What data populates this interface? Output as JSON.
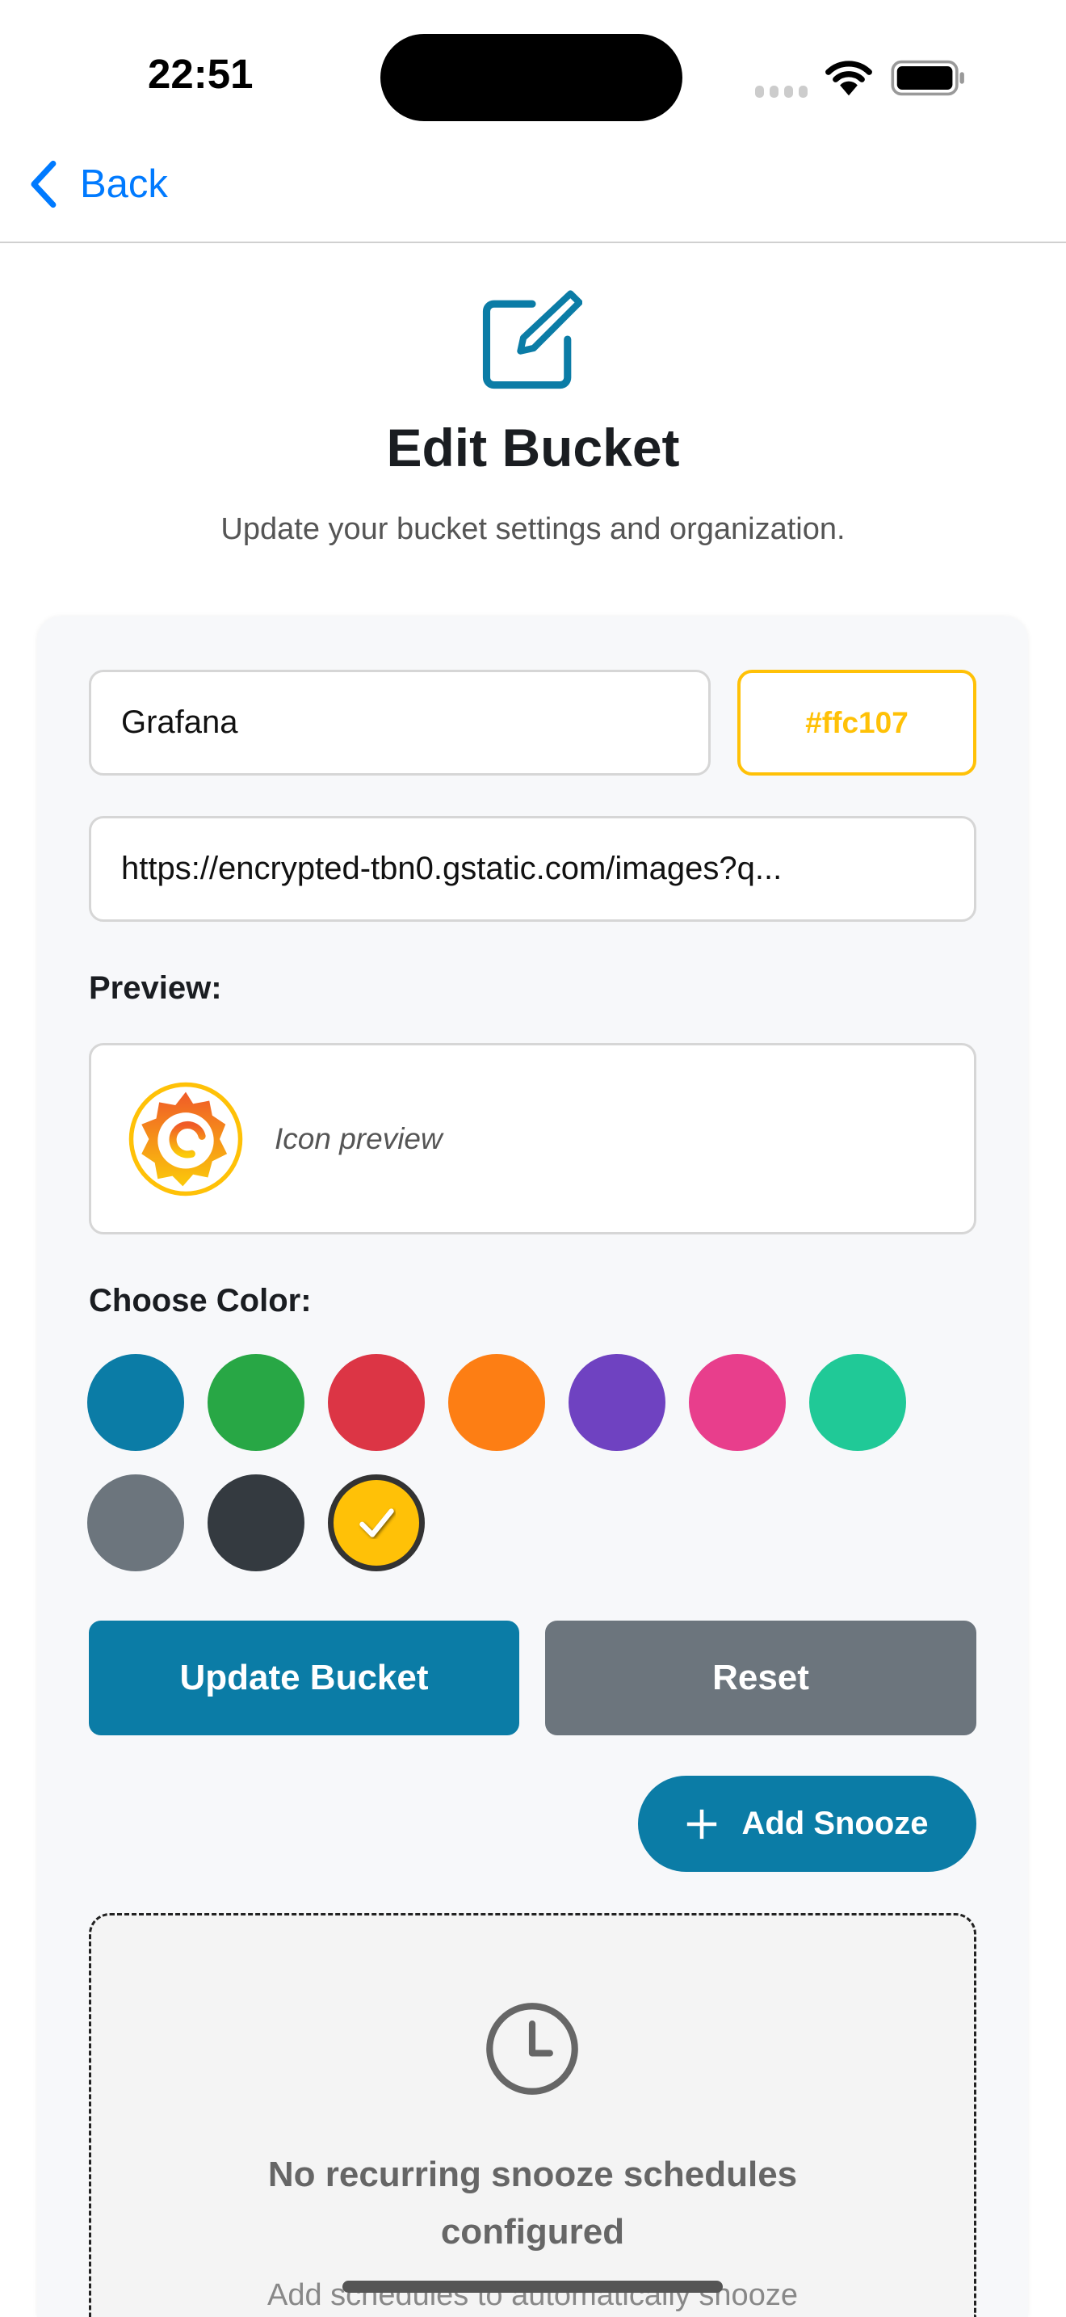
{
  "status_bar": {
    "time": "22:51"
  },
  "nav": {
    "back_label": "Back"
  },
  "header": {
    "title": "Edit Bucket",
    "subtitle": "Update your bucket settings and organization."
  },
  "form": {
    "name_value": "Grafana",
    "color_value": "#ffc107",
    "icon_url_value": "https://encrypted-tbn0.gstatic.com/images?q...",
    "preview_label": "Preview:",
    "preview_text": "Icon preview",
    "choose_color_label": "Choose Color:",
    "colors": [
      "#0b7ca6",
      "#28a745",
      "#dc3545",
      "#fd7e14",
      "#6f42c1",
      "#e83e8c",
      "#20c997",
      "#6c757d",
      "#343a40",
      "#ffc107"
    ],
    "selected_color": "#ffc107",
    "update_label": "Update Bucket",
    "reset_label": "Reset",
    "add_snooze_label": "Add Snooze"
  },
  "snooze": {
    "empty_title": "No recurring snooze schedules configured",
    "empty_subtitle": "Add schedules to automatically snooze"
  },
  "theme": {
    "accent": "#0b7ca6",
    "link": "#007aff",
    "secondary": "#6c757d"
  }
}
